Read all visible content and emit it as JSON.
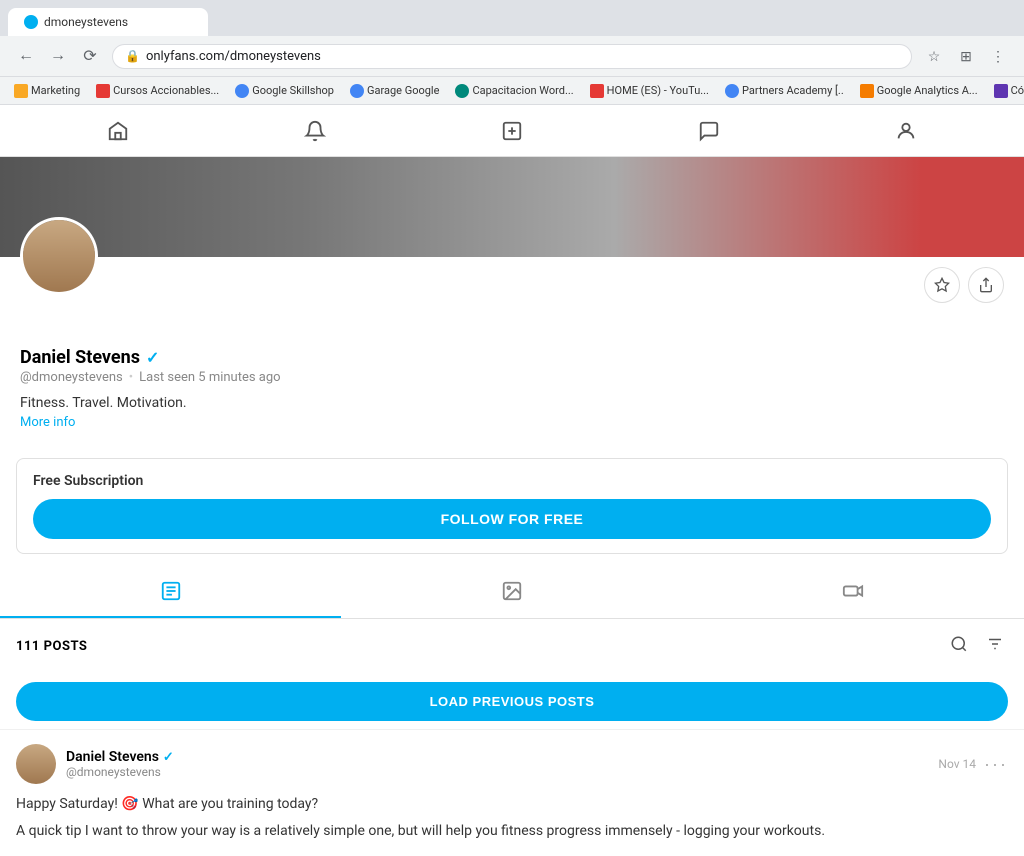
{
  "browser": {
    "tab_title": "dmoneystevens",
    "address": "onlyfans.com/dmoneystevens",
    "bookmarks": [
      {
        "label": "Marketing",
        "color": "#f9a825"
      },
      {
        "label": "Cursos Accionables...",
        "color": "#e53935"
      },
      {
        "label": "Google Skillshop",
        "color": "#4285f4"
      },
      {
        "label": "Garage Google",
        "color": "#4285f4"
      },
      {
        "label": "Capacitacion Word...",
        "color": "#00897b"
      },
      {
        "label": "HOME (ES) - YouTu...",
        "color": "#e53935"
      },
      {
        "label": "Partners Academy [..",
        "color": "#4285f4"
      },
      {
        "label": "Google Analytics A...",
        "color": "#f57c00"
      },
      {
        "label": "Cómo crea",
        "color": "#5e35b1"
      }
    ]
  },
  "nav": {
    "home_label": "home",
    "bell_label": "notifications",
    "plus_label": "create",
    "message_label": "messages",
    "profile_label": "profile"
  },
  "profile": {
    "name": "Daniel Stevens",
    "handle": "@dmoneystevens",
    "last_seen": "Last seen 5 minutes ago",
    "bio": "Fitness. Travel. Motivation.",
    "more_info_label": "More info",
    "verified": true
  },
  "subscription": {
    "title": "Free Subscription",
    "button_label": "FOLLOW FOR FREE"
  },
  "tabs": [
    {
      "icon": "☰",
      "label": "posts",
      "active": true
    },
    {
      "icon": "🖼",
      "label": "photos",
      "active": false
    },
    {
      "icon": "🎬",
      "label": "videos",
      "active": false
    }
  ],
  "posts_section": {
    "count_label": "111 POSTS",
    "load_prev_label": "LOAD PREVIOUS POSTS"
  },
  "post": {
    "author_name": "Daniel Stevens",
    "author_handle": "@dmoneystevens",
    "date": "Nov 14",
    "more_label": "···",
    "content_line1": "Happy Saturday! 🎯 What are you training today?",
    "content_line2": "A quick tip I want to throw your way is a relatively simple one, but will help you fitness progress immensely - logging your workouts."
  }
}
